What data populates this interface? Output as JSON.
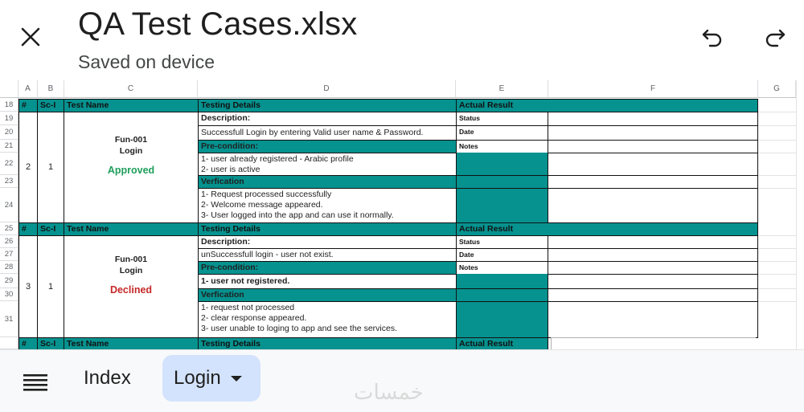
{
  "header": {
    "title": "QA Test Cases.xlsx",
    "subtitle": "Saved on device",
    "icons": {
      "close": "close-icon",
      "undo": "undo-icon",
      "redo": "redo-icon"
    }
  },
  "columns": [
    "A",
    "B",
    "C",
    "D",
    "E",
    "F",
    "G"
  ],
  "rows": [
    "18",
    "19",
    "20",
    "21",
    "22",
    "23",
    "24",
    "25",
    "26",
    "27",
    "28",
    "29",
    "30",
    "31"
  ],
  "table": {
    "header_labels": {
      "num": "#",
      "sc": "Sc-I",
      "name": "Test Name",
      "details": "Testing Details",
      "result": "Actual Result"
    },
    "result_labels": {
      "status": "Status",
      "date": "Date",
      "notes": "Notes"
    },
    "cases": [
      {
        "num": "2",
        "sc": "1",
        "name_line1": "Fun-001",
        "name_line2": "Login",
        "status": "Approved",
        "description_label": "Description:",
        "description": "Successfull Login by entering Valid user name & Password.",
        "precondition_label": "Pre-condition:",
        "preconditions": [
          "1- user already registered - Arabic profile",
          "2- user is active"
        ],
        "verification_label": "Verfication",
        "verifications": [
          "1- Request processed successfully",
          "2- Welcome message appeared.",
          "3- User logged into the app and can use it normally."
        ]
      },
      {
        "num": "3",
        "sc": "1",
        "name_line1": "Fun-001",
        "name_line2": "Login",
        "status": "Declined",
        "description_label": "Description:",
        "description": "unSuccessfull login - user not exist.",
        "precondition_label": "Pre-condition:",
        "preconditions": [
          "1- user not registered."
        ],
        "verification_label": "Verfication",
        "verifications": [
          "1- request not processed",
          "2- clear response appeared.",
          "3- user unable to loging to app and see the services."
        ]
      }
    ]
  },
  "bottom": {
    "tabs": [
      {
        "label": "Index"
      },
      {
        "label": "Login"
      }
    ],
    "watermark": "خمسات",
    "colors": {
      "active_tab": "#d3e3fd",
      "teal": "#06928f",
      "approved": "#1e9e5a",
      "declined": "#c62828"
    }
  }
}
